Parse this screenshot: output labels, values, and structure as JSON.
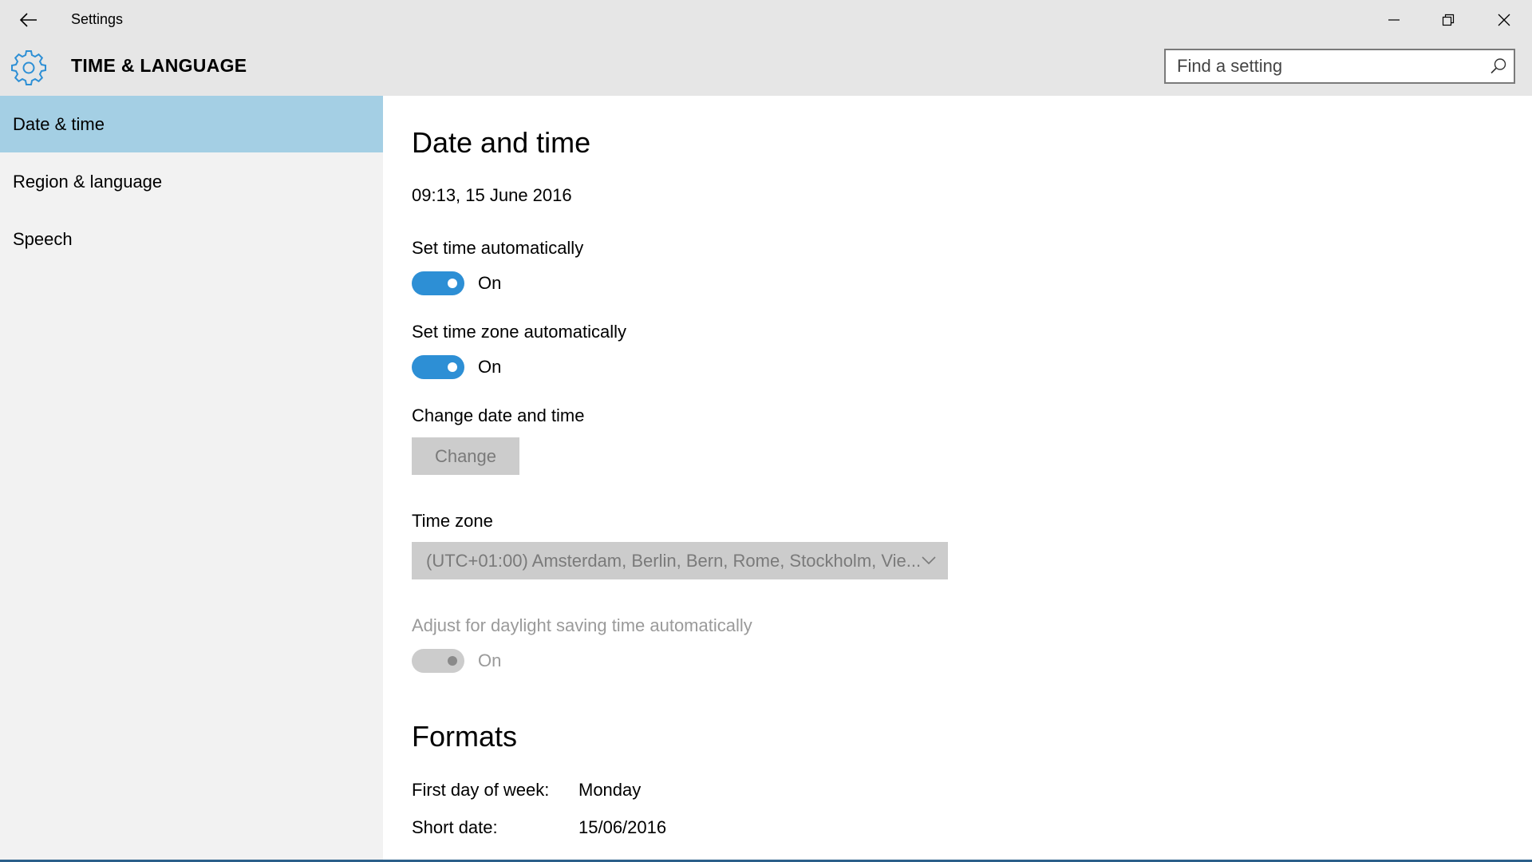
{
  "window": {
    "title": "Settings"
  },
  "header": {
    "section_title": "TIME & LANGUAGE",
    "search_placeholder": "Find a setting"
  },
  "sidebar": {
    "items": [
      {
        "label": "Date & time",
        "active": true
      },
      {
        "label": "Region & language",
        "active": false
      },
      {
        "label": "Speech",
        "active": false
      }
    ]
  },
  "main": {
    "heading": "Date and time",
    "current_datetime": "09:13, 15 June 2016",
    "set_time_auto": {
      "label": "Set time automatically",
      "state": "On"
    },
    "set_tz_auto": {
      "label": "Set time zone automatically",
      "state": "On"
    },
    "change_dt": {
      "label": "Change date and time",
      "button": "Change"
    },
    "time_zone": {
      "label": "Time zone",
      "value": "(UTC+01:00) Amsterdam, Berlin, Bern, Rome, Stockholm, Vie..."
    },
    "dst": {
      "label": "Adjust for daylight saving time automatically",
      "state": "On"
    },
    "formats": {
      "heading": "Formats",
      "first_day_label": "First day of week:",
      "first_day_value": "Monday",
      "short_date_label": "Short date:",
      "short_date_value": "15/06/2016"
    }
  },
  "colors": {
    "accent": "#2d8fd5",
    "selected_nav": "#a4cfe4",
    "disabled": "#cccccc"
  }
}
